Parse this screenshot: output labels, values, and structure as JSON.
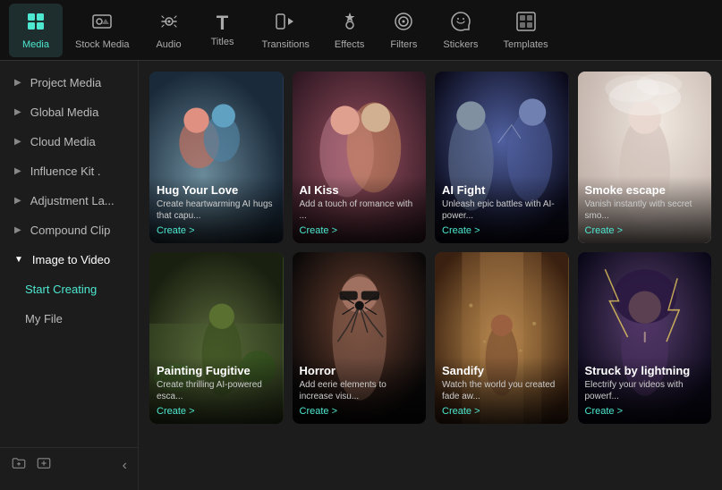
{
  "nav": {
    "items": [
      {
        "id": "media",
        "label": "Media",
        "icon": "⊞",
        "active": true
      },
      {
        "id": "stock-media",
        "label": "Stock Media",
        "icon": "🎞"
      },
      {
        "id": "audio",
        "label": "Audio",
        "icon": "♪"
      },
      {
        "id": "titles",
        "label": "Titles",
        "icon": "T"
      },
      {
        "id": "transitions",
        "label": "Transitions",
        "icon": "▶"
      },
      {
        "id": "effects",
        "label": "Effects",
        "icon": "✦"
      },
      {
        "id": "filters",
        "label": "Filters",
        "icon": "◎"
      },
      {
        "id": "stickers",
        "label": "Stickers",
        "icon": "✿"
      },
      {
        "id": "templates",
        "label": "Templates",
        "icon": "▣"
      }
    ]
  },
  "sidebar": {
    "items": [
      {
        "id": "project-media",
        "label": "Project Media",
        "collapsed": true
      },
      {
        "id": "global-media",
        "label": "Global Media",
        "collapsed": true
      },
      {
        "id": "cloud-media",
        "label": "Cloud Media",
        "collapsed": true
      },
      {
        "id": "influence-kit",
        "label": "Influence Kit .",
        "collapsed": true
      },
      {
        "id": "adjustment-la",
        "label": "Adjustment La...",
        "collapsed": true
      },
      {
        "id": "compound-clip",
        "label": "Compound Clip",
        "collapsed": true
      },
      {
        "id": "image-to-video",
        "label": "Image to Video",
        "expanded": true
      },
      {
        "id": "start-creating",
        "label": "Start Creating",
        "sub": true,
        "active": true
      },
      {
        "id": "my-file",
        "label": "My File",
        "sub": true
      }
    ]
  },
  "cards": [
    {
      "id": "hug-your-love",
      "title": "Hug Your Love",
      "desc": "Create heartwarming AI hugs that capu...",
      "create_label": "Create >",
      "bg_class": "bg-hug"
    },
    {
      "id": "ai-kiss",
      "title": "AI Kiss",
      "desc": "Add a touch of romance with ...",
      "create_label": "Create >",
      "bg_class": "bg-kiss"
    },
    {
      "id": "ai-fight",
      "title": "AI Fight",
      "desc": "Unleash epic battles with AI-power...",
      "create_label": "Create >",
      "bg_class": "bg-fight"
    },
    {
      "id": "smoke-escape",
      "title": "Smoke escape",
      "desc": "Vanish instantly with secret smo...",
      "create_label": "Create >",
      "bg_class": "bg-smoke"
    },
    {
      "id": "painting-fugitive",
      "title": "Painting Fugitive",
      "desc": "Create thrilling AI-powered esca...",
      "create_label": "Create >",
      "bg_class": "bg-painting"
    },
    {
      "id": "horror",
      "title": "Horror",
      "desc": "Add eerie elements to increase visu...",
      "create_label": "Create >",
      "bg_class": "bg-horror"
    },
    {
      "id": "sandify",
      "title": "Sandify",
      "desc": "Watch the world you created fade aw...",
      "create_label": "Create >",
      "bg_class": "bg-sandify"
    },
    {
      "id": "struck-by-lightning",
      "title": "Struck by lightning",
      "desc": "Electrify your videos with powerf...",
      "create_label": "Create >",
      "bg_class": "bg-lightning"
    }
  ],
  "icons": {
    "chevron_right": "▶",
    "chevron_down": "▼",
    "folder_add": "📁",
    "media_add": "🖼",
    "collapse": "‹"
  }
}
